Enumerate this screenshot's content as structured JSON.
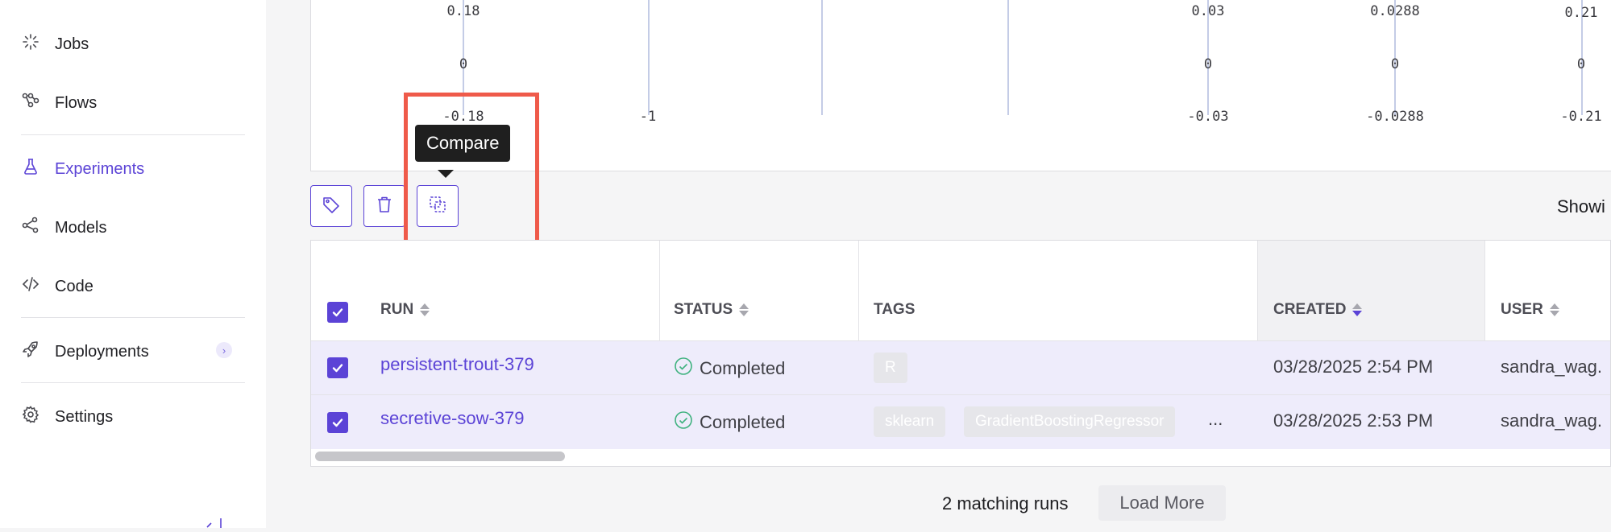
{
  "sidebar": {
    "items": [
      {
        "label": "Jobs",
        "icon": "loader-icon"
      },
      {
        "label": "Flows",
        "icon": "flow-icon"
      },
      {
        "label": "Experiments",
        "icon": "flask-icon",
        "active": true
      },
      {
        "label": "Models",
        "icon": "models-icon"
      },
      {
        "label": "Code",
        "icon": "code-icon"
      },
      {
        "label": "Deployments",
        "icon": "rocket-icon",
        "expandable": true
      },
      {
        "label": "Settings",
        "icon": "gear-icon"
      }
    ]
  },
  "plot": {
    "axes": [
      {
        "top": "0.18",
        "mid": "0",
        "bottom": "-0.18"
      },
      {
        "top": "",
        "mid": "",
        "bottom": "-1"
      },
      {
        "top": "",
        "mid": "",
        "bottom": ""
      },
      {
        "top": "",
        "mid": "",
        "bottom": ""
      },
      {
        "top": "0.03",
        "mid": "0",
        "bottom": "-0.03"
      },
      {
        "top": "0.0288",
        "mid": "0",
        "bottom": "-0.0288"
      },
      {
        "top": "0.21",
        "mid": "0",
        "bottom": "-0.21"
      }
    ]
  },
  "toolbar": {
    "tooltip": "Compare",
    "showing": "Showi"
  },
  "table": {
    "headers": {
      "run": "RUN",
      "status": "STATUS",
      "tags": "TAGS",
      "created": "CREATED",
      "user": "USER"
    },
    "rows": [
      {
        "run": "persistent-trout-379",
        "status": "Completed",
        "tags": [
          "R"
        ],
        "more_tags": "",
        "created": "03/28/2025 2:54 PM",
        "user": "sandra_wag."
      },
      {
        "run": "secretive-sow-379",
        "status": "Completed",
        "tags": [
          "sklearn",
          "GradientBoostingRegressor"
        ],
        "more_tags": "...",
        "created": "03/28/2025 2:53 PM",
        "user": "sandra_wag."
      }
    ]
  },
  "footer": {
    "count": "2 matching runs",
    "load_more": "Load More"
  },
  "colors": {
    "accent": "#5b43d6",
    "highlight": "#ef5a4a",
    "status_ok": "#3fb27f"
  }
}
